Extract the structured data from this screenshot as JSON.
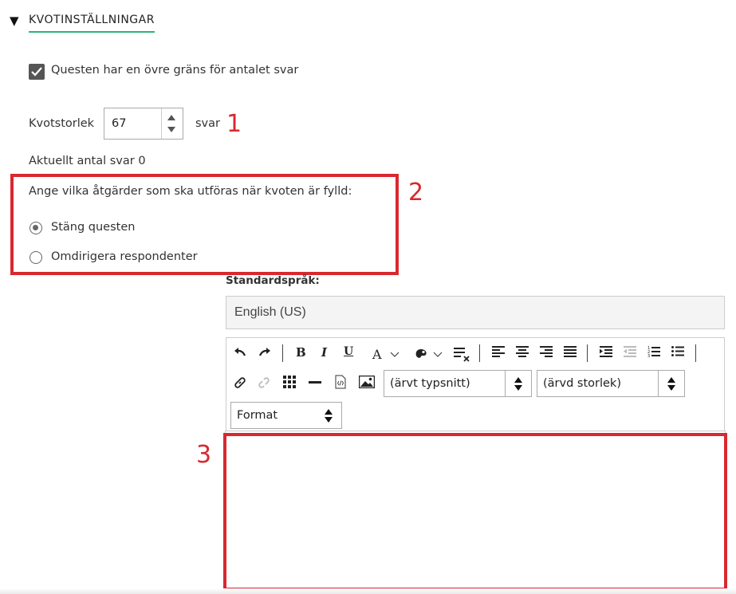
{
  "section": {
    "arrow": "▼",
    "title": "KVOTINSTÄLLNINGAR"
  },
  "checkbox": {
    "label": "Questen har en övre gräns för antalet svar",
    "checked": true
  },
  "quota": {
    "label": "Kvotstorlek",
    "value": "67",
    "unit": "svar"
  },
  "current_count": "Aktuellt antal svar 0",
  "actions": {
    "question": "Ange vilka åtgärder som ska utföras när kvoten är fylld:",
    "options": [
      {
        "label": "Stäng questen",
        "selected": true
      },
      {
        "label": "Omdirigera respondenter",
        "selected": false
      }
    ]
  },
  "language": {
    "label": "Standardspråk:",
    "value": "English (US)"
  },
  "toolbar": {
    "icons": [
      "undo-icon",
      "redo-icon",
      "bold-icon",
      "italic-icon",
      "underline-icon",
      "font-color-icon",
      "background-color-icon",
      "remove-format-icon",
      "align-left-icon",
      "align-center-icon",
      "align-right-icon",
      "justify-icon",
      "indent-icon",
      "outdent-icon",
      "ordered-list-icon",
      "unordered-list-icon",
      "link-icon",
      "unlink-icon",
      "table-icon",
      "horizontal-rule-icon",
      "source-code-icon",
      "image-icon"
    ],
    "glyphs": {
      "bold": "B",
      "italic": "I",
      "underline": "U",
      "font_color": "A"
    },
    "font_select": "(ärvt typsnitt)",
    "size_select": "(ärvd storlek)",
    "format_select": "Format"
  },
  "annotations": [
    "1",
    "2",
    "3"
  ],
  "colors": {
    "annotation_red": "#d9282f",
    "underline_green": "#2bb57a"
  }
}
